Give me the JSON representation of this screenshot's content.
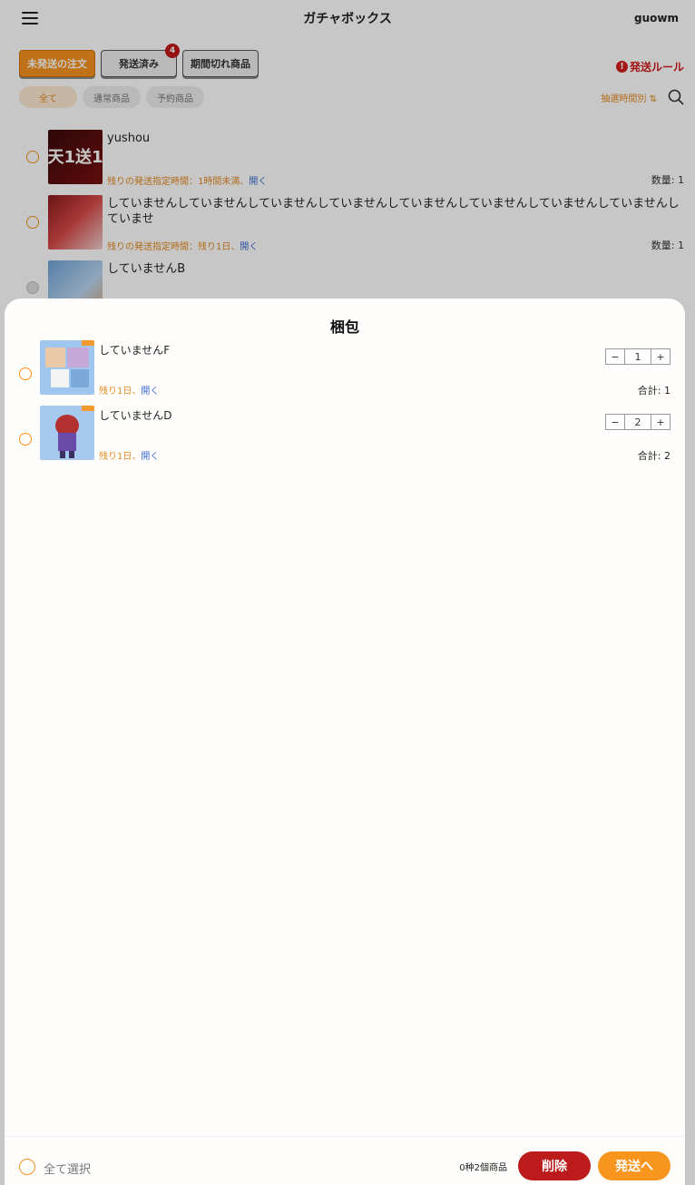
{
  "header": {
    "title": "ガチャボックス",
    "username": "guowm"
  },
  "tabs": [
    {
      "label": "未発送の注文",
      "active": true
    },
    {
      "label": "発送済み",
      "badge": "4"
    },
    {
      "label": "期間切れ商品"
    }
  ],
  "rules_link": "発送ルール",
  "filters": [
    {
      "label": "全て",
      "active": true
    },
    {
      "label": "通常商品"
    },
    {
      "label": "予約商品"
    }
  ],
  "sort_label": "抽選時間別",
  "orders": [
    {
      "name": "yushou",
      "remain": "残りの発送指定時間：1時間未満、",
      "open": "開く",
      "qty": "数量: 1"
    },
    {
      "name": "していませんしていませんしていませんしていませんしていませんしていませんしていませんしていませんしていませ",
      "remain": "残りの発送指定時間：残り1日、",
      "open": "開く",
      "qty": "数量: 1"
    },
    {
      "name": "していませんB"
    }
  ],
  "sheet": {
    "title": "梱包",
    "items": [
      {
        "name": "していませんF",
        "remain": "残り1日、",
        "open": "開く",
        "quantity": "1",
        "total": "合計: 1"
      },
      {
        "name": "していませんD",
        "remain": "残り1日、",
        "open": "開く",
        "quantity": "2",
        "total": "合計: 2"
      }
    ],
    "select_all": "全て選択",
    "summary": "0种2個商品",
    "delete_label": "削除",
    "ship_label": "発送へ"
  },
  "colors": {
    "accent_orange": "#f5921e",
    "delete_red": "#bb1b1b",
    "rules_red": "#d31e1e",
    "link_blue": "#3a6bd1"
  }
}
